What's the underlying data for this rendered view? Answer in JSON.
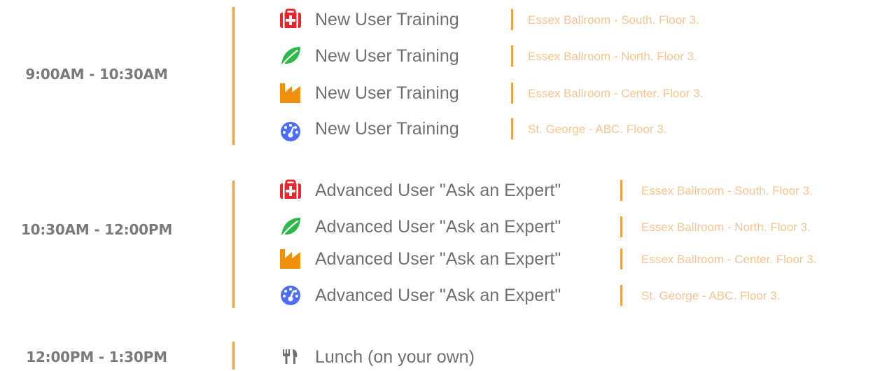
{
  "blocks": [
    {
      "time": "9:00AM - 10:30AM",
      "sessions": [
        {
          "icon": "medical-kit-icon",
          "title": "New User Training",
          "location": "Essex Ballroom - South. Floor 3."
        },
        {
          "icon": "leaf-icon",
          "title": "New User Training",
          "location": "Essex Ballroom - North. Floor 3."
        },
        {
          "icon": "factory-icon",
          "title": "New User Training",
          "location": "Essex Ballroom - Center. Floor 3."
        },
        {
          "icon": "dashboard-gauge-icon",
          "title": "New User Training",
          "location": "St. George - ABC. Floor 3."
        }
      ]
    },
    {
      "time": "10:30AM - 12:00PM",
      "sessions": [
        {
          "icon": "medical-kit-icon",
          "title": "Advanced User \"Ask an Expert\"",
          "location": "Essex Ballroom - South. Floor 3."
        },
        {
          "icon": "leaf-icon",
          "title": "Advanced User \"Ask an Expert\"",
          "location": "Essex Ballroom - North. Floor 3."
        },
        {
          "icon": "factory-icon",
          "title": "Advanced User \"Ask an Expert\"",
          "location": "Essex Ballroom - Center. Floor 3."
        },
        {
          "icon": "dashboard-gauge-icon",
          "title": "Advanced User \"Ask an Expert\"",
          "location": "St. George - ABC. Floor 3."
        }
      ]
    },
    {
      "time": "12:00PM - 1:30PM",
      "sessions": [
        {
          "icon": "fork-knife-icon",
          "title": "Lunch (on your own)"
        }
      ]
    }
  ],
  "colors": {
    "accent": "#f0a040",
    "location_text": "#f7c48e",
    "time_text": "#7a7a7a",
    "title_text": "#707070",
    "medical_red": "#e8262a",
    "leaf_green": "#2db84a",
    "factory_orange": "#f0900a",
    "gauge_blue": "#4a6ef5",
    "lunch_gray": "#707070"
  }
}
